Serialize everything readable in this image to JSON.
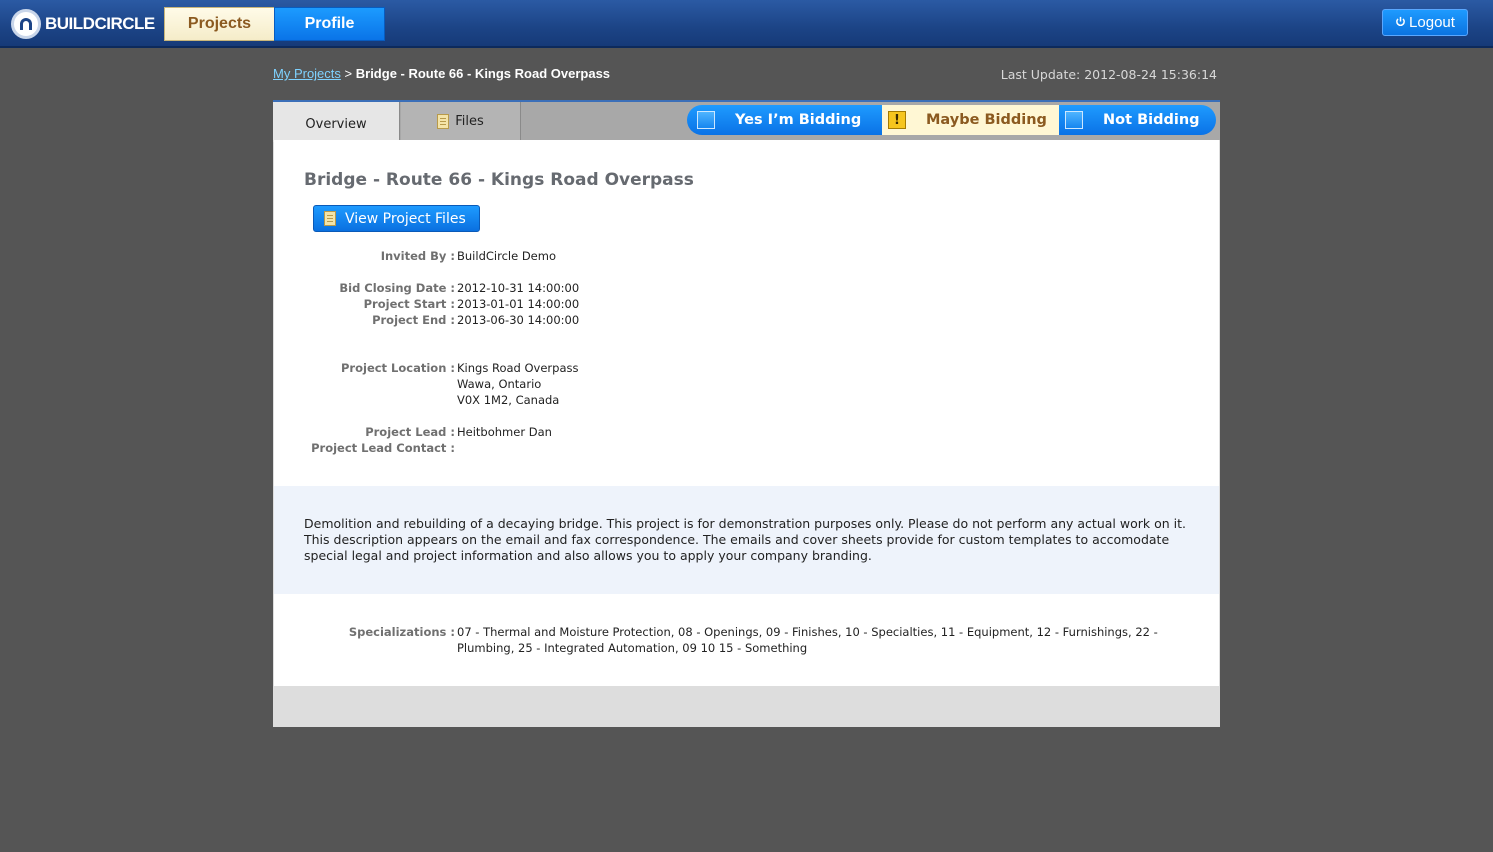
{
  "brand": {
    "name": "BUILDCIRCLE"
  },
  "nav": {
    "projects": "Projects",
    "profile": "Profile",
    "logout": "Logout"
  },
  "breadcrumb": {
    "root": "My Projects",
    "separator": ">",
    "current": "Bridge - Route 66 - Kings Road Overpass"
  },
  "last_update": "Last Update: 2012-08-24 15:36:14",
  "tabs": {
    "overview": "Overview",
    "files": "Files"
  },
  "bidding": {
    "yes": "Yes I’m Bidding",
    "maybe": "Maybe Bidding",
    "not": "Not Bidding",
    "warn_glyph": "!"
  },
  "project": {
    "title": "Bridge - Route 66 - Kings Road Overpass",
    "view_files_label": "View Project Files",
    "invited_by": {
      "label": "Invited By :",
      "value": "BuildCircle Demo"
    },
    "bid_closing": {
      "label": "Bid Closing Date :",
      "value": "2012-10-31 14:00:00"
    },
    "start": {
      "label": "Project Start :",
      "value": "2013-01-01 14:00:00"
    },
    "end": {
      "label": "Project End :",
      "value": "2013-06-30 14:00:00"
    },
    "location": {
      "label": "Project Location :",
      "line1": "Kings Road Overpass",
      "line2": "Wawa, Ontario",
      "line3": "V0X 1M2, Canada"
    },
    "lead": {
      "label": "Project Lead :",
      "value": "Heitbohmer Dan"
    },
    "lead_contact": {
      "label": "Project Lead Contact :",
      "value": ""
    },
    "description": "Demolition and rebuilding of a decaying bridge. This project is for demonstration purposes only. Please do not perform any actual work on it. This description appears on the email and fax correspondence. The emails and cover sheets provide for custom templates to accomodate special legal and project information and also allows you to apply your company branding.",
    "specializations": {
      "label": "Specializations :",
      "value": "07 - Thermal and Moisture Protection, 08 - Openings, 09 - Finishes, 10 - Specialties, 11 - Equipment, 12 - Furnishings, 22 - Plumbing, 25 - Integrated Automation, 09 10 15 - Something"
    }
  },
  "colors": {
    "accent_blue": "#0a72e6",
    "page_bg": "#555555",
    "maybe_bg": "#fff7d4"
  },
  "icons": {
    "logo": "buildcircle-logo-icon",
    "logout": "power-icon",
    "files": "document-icon",
    "check": "checkbox-icon",
    "warning": "warning-icon"
  }
}
